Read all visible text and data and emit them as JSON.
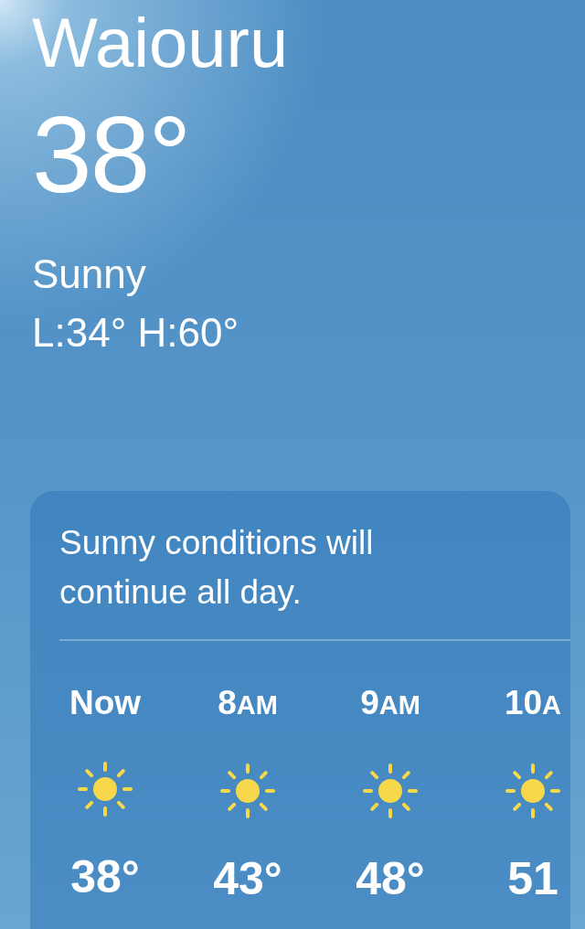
{
  "location": "Waiouru",
  "temperature": "38°",
  "condition": "Sunny",
  "low_high": "L:34° H:60°",
  "forecast_card": {
    "summary": "Sunny conditions will continue all day.",
    "hours": [
      {
        "hour": "Now",
        "kind": "sun",
        "temp": "38°"
      },
      {
        "hour": "8",
        "period": "AM",
        "kind": "sun",
        "temp": "43°"
      },
      {
        "hour": "9",
        "period": "AM",
        "kind": "sun",
        "temp": "48°"
      },
      {
        "hour": "10",
        "period": "A",
        "kind": "sun",
        "temp": "51"
      }
    ]
  }
}
